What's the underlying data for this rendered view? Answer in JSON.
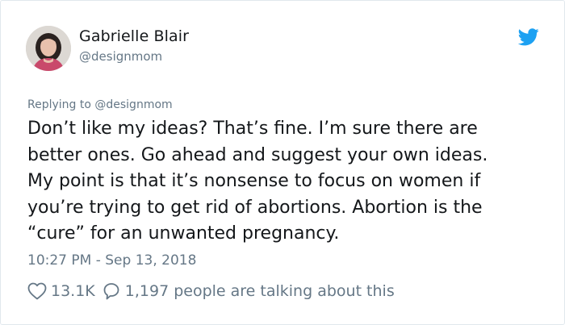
{
  "author": {
    "name": "Gabrielle Blair",
    "handle": "@designmom"
  },
  "tweet": {
    "replying_to": "Replying to @designmom",
    "lines": [
      "Don’t like my ideas? That’s fine. I’m sure there are",
      "better ones. Go ahead and suggest your own ideas.",
      "My point is that it’s nonsense to focus on women if",
      "you’re trying to get rid of abortions. Abortion is the",
      "“cure” for an unwanted pregnancy."
    ],
    "timestamp": "10:27 PM - Sep 13, 2018"
  },
  "engagement": {
    "likes": "13.1K",
    "talking": "1,197 people are talking about this"
  },
  "icons": {
    "brand": "twitter-bird-icon",
    "like": "heart-icon",
    "reply": "speech-bubble-icon"
  },
  "colors": {
    "twitter_blue": "#1da1f2",
    "secondary_text": "#657786",
    "primary_text": "#14171a",
    "border": "#e1e8ed"
  }
}
